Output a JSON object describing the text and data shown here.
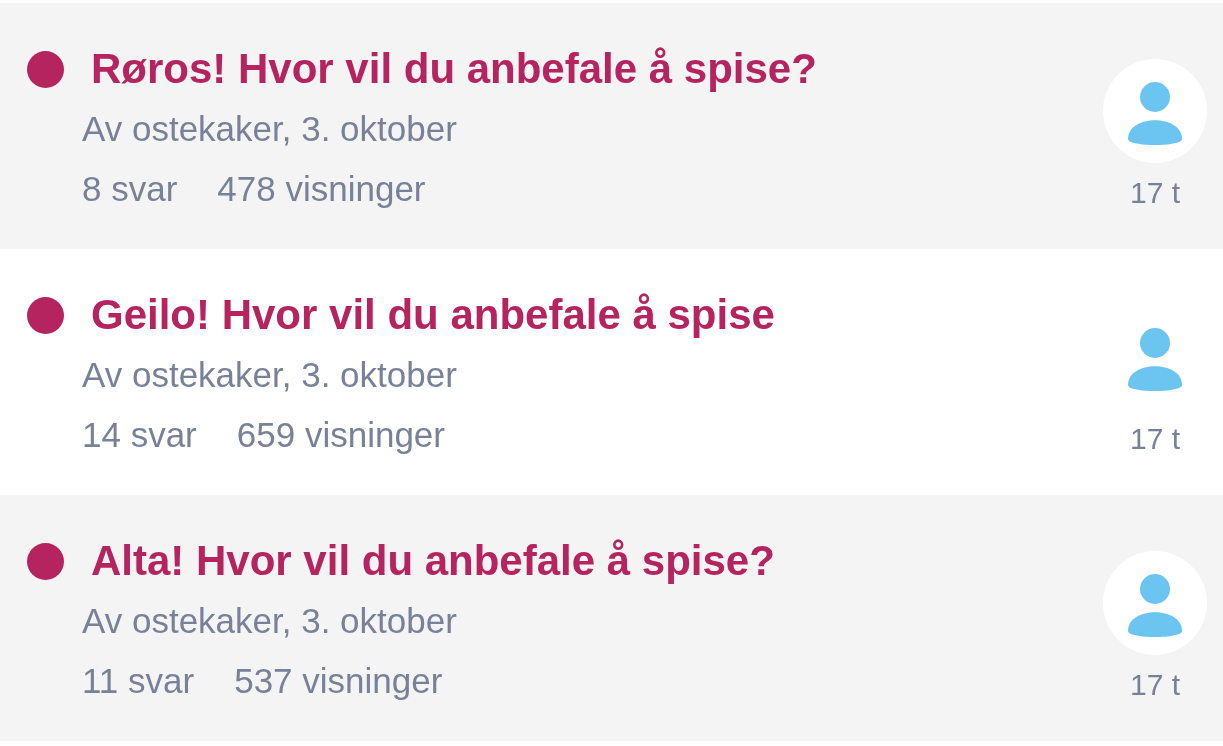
{
  "topics": [
    {
      "title": "Røros! Hvor vil du anbefale å spise?",
      "unread": true,
      "byline": "Av ostekaker, 3. oktober",
      "replies": "8 svar",
      "views": "478 visninger",
      "age": "17 t"
    },
    {
      "title": "Geilo! Hvor vil du anbefale å spise",
      "unread": true,
      "byline": "Av ostekaker, 3. oktober",
      "replies": "14 svar",
      "views": "659 visninger",
      "age": "17 t"
    },
    {
      "title": "Alta! Hvor vil du anbefale å spise?",
      "unread": true,
      "byline": "Av ostekaker, 3. oktober",
      "replies": "11 svar",
      "views": "537 visninger",
      "age": "17 t"
    }
  ]
}
